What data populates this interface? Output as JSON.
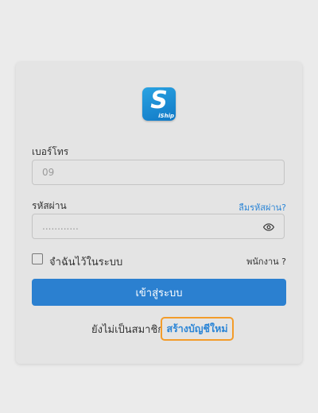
{
  "logo": {
    "text": "iShip"
  },
  "phone": {
    "label": "เบอร์โทร",
    "placeholder": "09"
  },
  "password": {
    "label": "รหัสผ่าน",
    "placeholder": "............",
    "forgot_link": "ลืมรหัสผ่าน?"
  },
  "remember": {
    "label": "จำฉันไว้ในระบบ"
  },
  "staff_link": "พนักงาน ?",
  "login_button": "เข้าสู่ระบบ",
  "signup": {
    "prompt": "ยังไม่เป็นสมาชิก",
    "link": "สร้างบัญชีใหม่"
  },
  "colors": {
    "accent": "#2b80d0",
    "highlight": "#f39c2a"
  }
}
